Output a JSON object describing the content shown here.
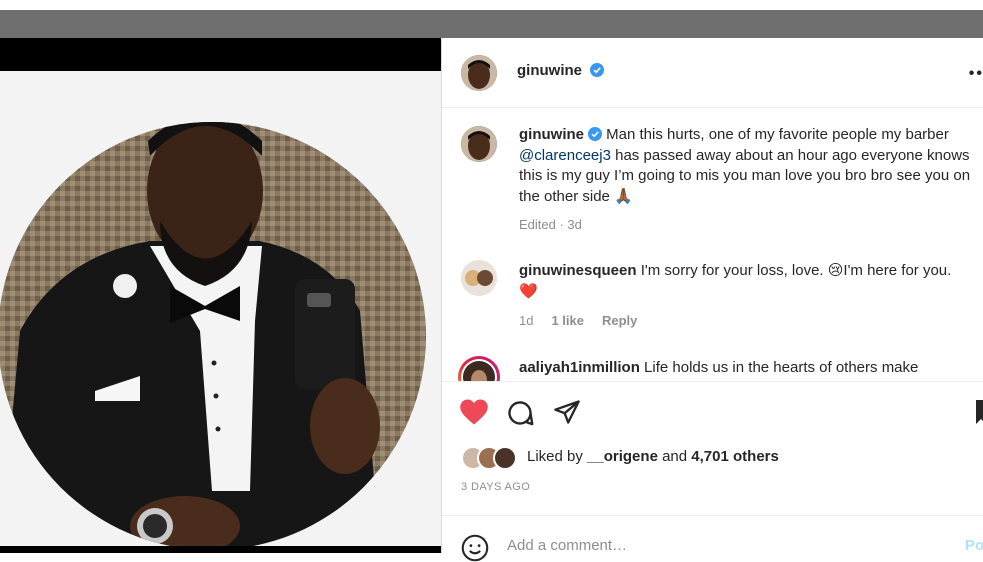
{
  "post": {
    "author": "ginuwine",
    "verified": true,
    "more_icon": "more-horizontal-icon"
  },
  "caption": {
    "username": "ginuwine",
    "text_before_mention": "Man this hurts, one of my favorite people my barber",
    "mention": "@clarenceej3",
    "text_after_mention": "has passed away about an hour ago everyone knows this is my guy I’m going to mis you man love you bro bro see you on the other side 🙏🏾",
    "meta": "Edited · 3d"
  },
  "comments": [
    {
      "username": "ginuwinesqueen",
      "text": "I'm sorry for your loss, love. 😢I'm here for you.❤️",
      "age": "1d",
      "likes": "1 like",
      "reply": "Reply"
    },
    {
      "username": "aaliyah1inmillion",
      "text": "Life holds us in the hearts of others make"
    }
  ],
  "actions": {
    "like_icon": "heart-filled-icon",
    "comment_icon": "comment-icon",
    "share_icon": "share-icon",
    "save_icon": "bookmark-icon",
    "like_color": "#ed4956"
  },
  "likes": {
    "prefix": "Liked by",
    "first_liker": "__origene",
    "conjunction": "and",
    "others": "4,701 others"
  },
  "timestamp": "3 DAYS AGO",
  "add_comment": {
    "placeholder": "Add a comment…",
    "post_label": "Post",
    "emoji_icon": "emoji-icon"
  }
}
